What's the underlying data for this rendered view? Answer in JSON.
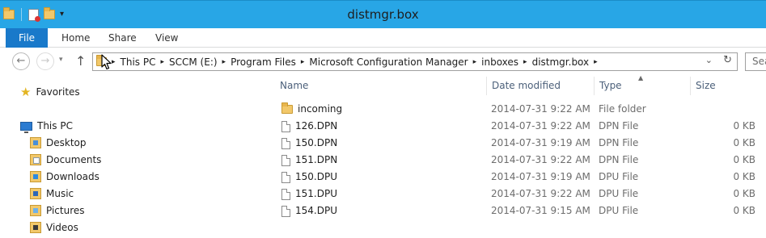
{
  "window": {
    "title": "distmgr.box"
  },
  "quick_access": {
    "icons": [
      "folder-icon",
      "properties-icon",
      "new-folder-icon"
    ],
    "customize_glyph": "▾"
  },
  "ribbon": {
    "tabs": [
      "File",
      "Home",
      "Share",
      "View"
    ]
  },
  "nav": {
    "back_glyph": "←",
    "forward_glyph": "→",
    "recent_glyph": "▾",
    "up_glyph": "↑",
    "breadcrumbs": [
      "This PC",
      "SCCM (E:)",
      "Program Files",
      "Microsoft Configuration Manager",
      "inboxes",
      "distmgr.box"
    ],
    "crumb_separator": "▸",
    "dropdown_glyph": "⌄",
    "refresh_glyph": "↻",
    "search_placeholder": "Sea"
  },
  "nav_pane": {
    "favorites": "Favorites",
    "this_pc": "This PC",
    "items": [
      "Desktop",
      "Documents",
      "Downloads",
      "Music",
      "Pictures",
      "Videos"
    ]
  },
  "columns": {
    "name": "Name",
    "date": "Date modified",
    "type": "Type",
    "size": "Size"
  },
  "files": [
    {
      "name": "incoming",
      "date": "2014-07-31 9:22 AM",
      "type": "File folder",
      "size": "",
      "kind": "folder"
    },
    {
      "name": "126.DPN",
      "date": "2014-07-31 9:22 AM",
      "type": "DPN File",
      "size": "0 KB",
      "kind": "file"
    },
    {
      "name": "150.DPN",
      "date": "2014-07-31 9:19 AM",
      "type": "DPN File",
      "size": "0 KB",
      "kind": "file"
    },
    {
      "name": "151.DPN",
      "date": "2014-07-31 9:22 AM",
      "type": "DPN File",
      "size": "0 KB",
      "kind": "file"
    },
    {
      "name": "150.DPU",
      "date": "2014-07-31 9:19 AM",
      "type": "DPU File",
      "size": "0 KB",
      "kind": "file"
    },
    {
      "name": "151.DPU",
      "date": "2014-07-31 9:22 AM",
      "type": "DPU File",
      "size": "0 KB",
      "kind": "file"
    },
    {
      "name": "154.DPU",
      "date": "2014-07-31 9:15 AM",
      "type": "DPU File",
      "size": "0 KB",
      "kind": "file"
    }
  ],
  "colors": {
    "titlebar": "#28a6e6",
    "file_tab": "#1979ca",
    "header_text": "#4c607a"
  }
}
